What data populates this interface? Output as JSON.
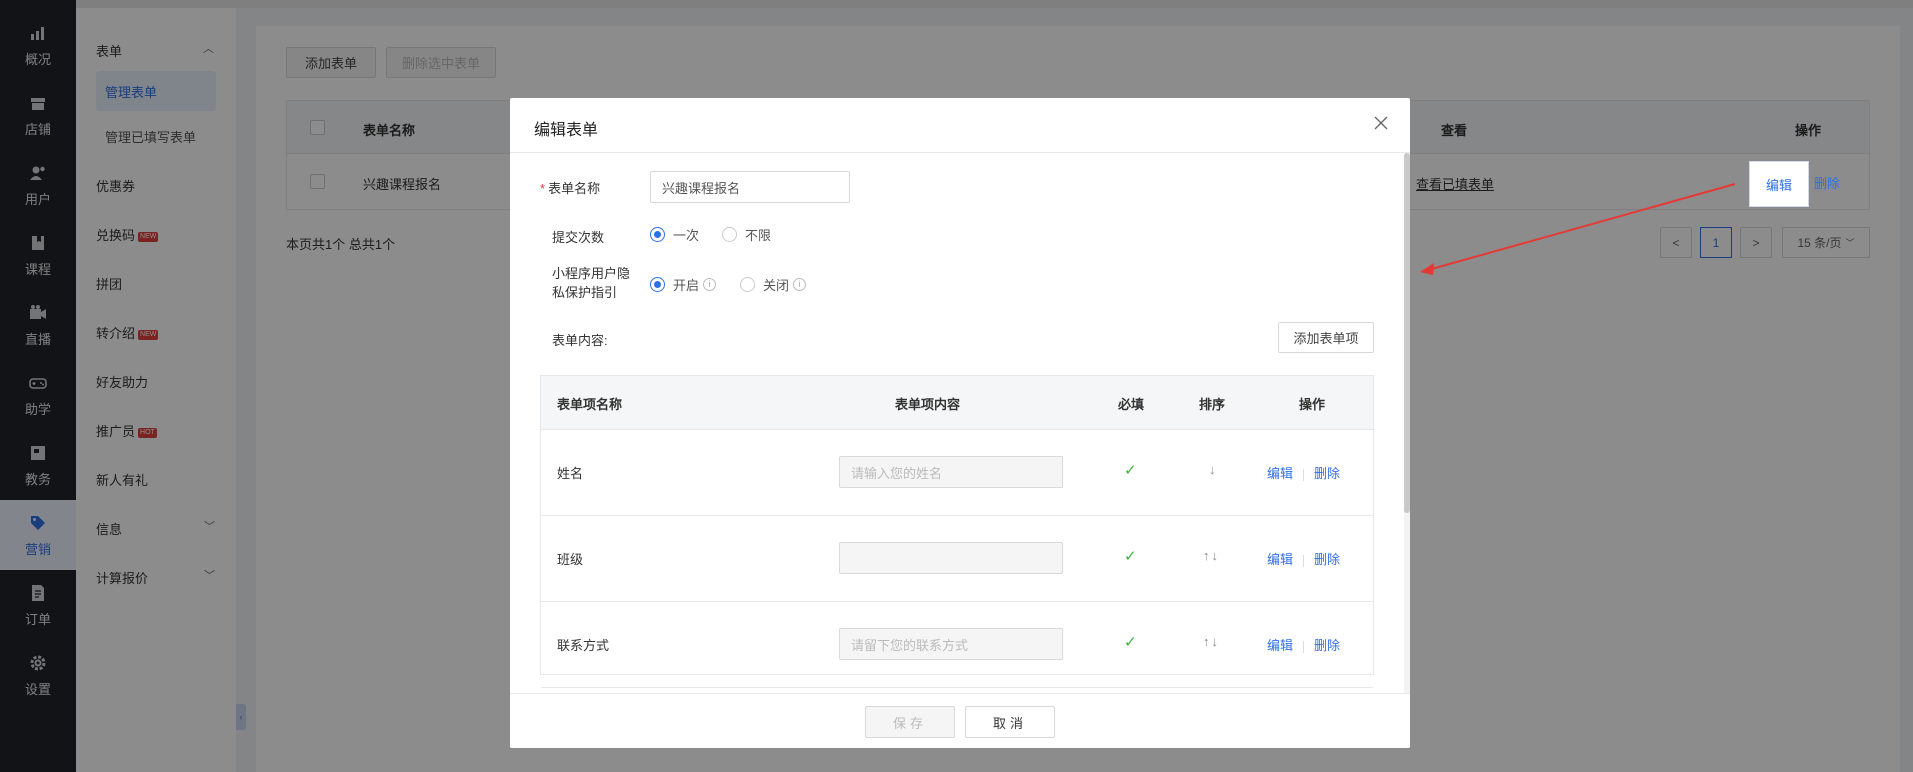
{
  "nav": {
    "items": [
      {
        "label": "概况",
        "icon": "chart-icon"
      },
      {
        "label": "店铺",
        "icon": "store-icon"
      },
      {
        "label": "用户",
        "icon": "users-icon"
      },
      {
        "label": "课程",
        "icon": "book-icon"
      },
      {
        "label": "直播",
        "icon": "video-icon"
      },
      {
        "label": "助学",
        "icon": "gamepad-icon"
      },
      {
        "label": "教务",
        "icon": "calendar-icon"
      },
      {
        "label": "营销",
        "icon": "tag-icon"
      },
      {
        "label": "订单",
        "icon": "document-icon"
      },
      {
        "label": "设置",
        "icon": "gear-icon"
      }
    ]
  },
  "sidebar": {
    "group_label": "表单",
    "children": [
      "管理表单",
      "管理已填写表单"
    ],
    "items": [
      {
        "label": "优惠券"
      },
      {
        "label": "兑换码",
        "badge": "NEW"
      },
      {
        "label": "拼团"
      },
      {
        "label": "转介绍",
        "badge": "NEW"
      },
      {
        "label": "好友助力"
      },
      {
        "label": "推广员",
        "badge": "HOT"
      },
      {
        "label": "新人有礼"
      },
      {
        "label": "信息"
      },
      {
        "label": "计算报价"
      }
    ]
  },
  "toolbar": {
    "add_form": "添加表单",
    "delete_selected": "删除选中表单"
  },
  "table": {
    "headers": {
      "name": "表单名称",
      "view": "查看",
      "ops": "操作"
    },
    "rows": [
      {
        "name": "兴趣课程报名",
        "view_link": "查看已填表单",
        "edit": "编辑",
        "delete": "删除"
      }
    ]
  },
  "pagination": {
    "summary": "本页共1个 总共1个",
    "prev": "<",
    "current": "1",
    "next": ">",
    "page_size": "15 条/页"
  },
  "modal": {
    "title": "编辑表单",
    "form_name_label": "表单名称",
    "form_name_value": "兴趣课程报名",
    "submit_times_label": "提交次数",
    "submit_options": [
      "一次",
      "不限"
    ],
    "privacy_label_line1": "小程序用户隐",
    "privacy_label_line2": "私保护指引",
    "privacy_options": [
      "开启",
      "关闭"
    ],
    "content_label": "表单内容:",
    "add_item_button": "添加表单项",
    "inner_headers": {
      "name": "表单项名称",
      "content": "表单项内容",
      "required": "必填",
      "sort": "排序",
      "ops": "操作"
    },
    "inner_rows": [
      {
        "name": "姓名",
        "placeholder": "请输入您的姓名",
        "sort": "↓",
        "edit": "编辑",
        "delete": "删除"
      },
      {
        "name": "班级",
        "placeholder": "",
        "sort": "↑↓",
        "edit": "编辑",
        "delete": "删除"
      },
      {
        "name": "联系方式",
        "placeholder": "请留下您的联系方式",
        "sort": "↑↓",
        "edit": "编辑",
        "delete": "删除"
      }
    ],
    "save_button": "保存",
    "cancel_button": "取消"
  },
  "colors": {
    "accent": "#2f6fe4",
    "nav_bg": "#1f2329",
    "annotation_arrow": "#e53935",
    "check": "#3bb33b"
  }
}
